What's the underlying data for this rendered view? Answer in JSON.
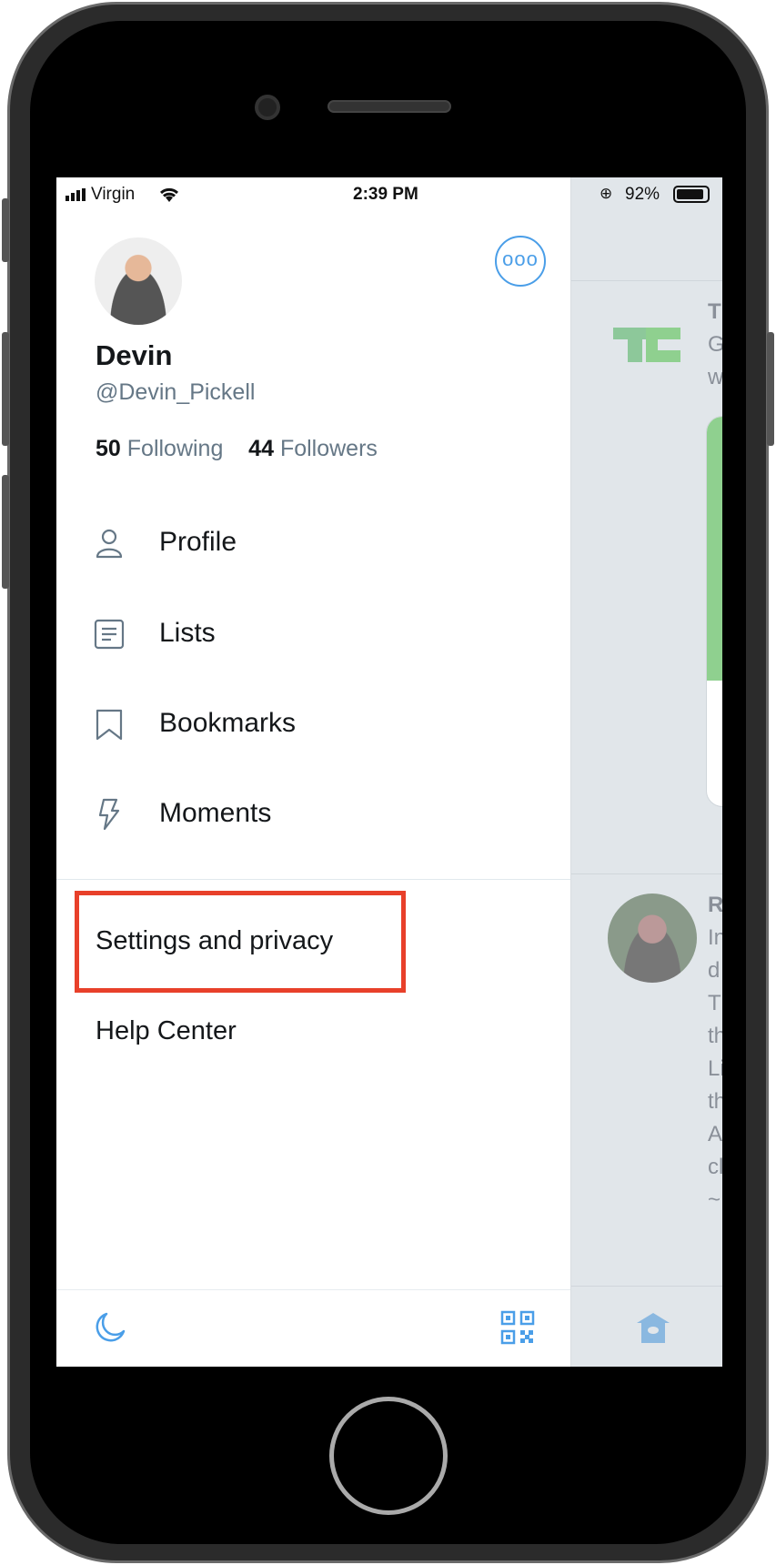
{
  "status_bar": {
    "carrier": "Virgin",
    "time": "2:39 PM",
    "battery": "92%",
    "battery_level": 0.92
  },
  "profile": {
    "name": "Devin",
    "handle": "@Devin_Pickell",
    "following_count": "50",
    "following_label": "Following",
    "followers_count": "44",
    "followers_label": "Followers"
  },
  "more_button": {
    "icon": "more-horizontal-icon",
    "label": "ooo"
  },
  "menu": [
    {
      "label": "Profile",
      "icon": "person-icon"
    },
    {
      "label": "Lists",
      "icon": "list-icon"
    },
    {
      "label": "Bookmarks",
      "icon": "bookmark-icon"
    },
    {
      "label": "Moments",
      "icon": "lightning-icon"
    }
  ],
  "secondary": [
    {
      "label": "Settings and privacy",
      "highlighted": true
    },
    {
      "label": "Help Center"
    }
  ],
  "bottom_bar": {
    "left_icon": "moon-icon",
    "right_icon": "qr-code-icon"
  },
  "background_feed": {
    "tweet1_letters": [
      "T",
      "G",
      "w"
    ],
    "tweet2_letters": [
      "R",
      "In",
      "d",
      "T",
      "th",
      "Li",
      "th",
      "A",
      "cl",
      "~"
    ],
    "nav_icon": "home-icon"
  },
  "colors": {
    "accent": "#4a9ee8",
    "highlight_box": "#e8402a",
    "text": "#14171a",
    "secondary_text": "#657786"
  }
}
